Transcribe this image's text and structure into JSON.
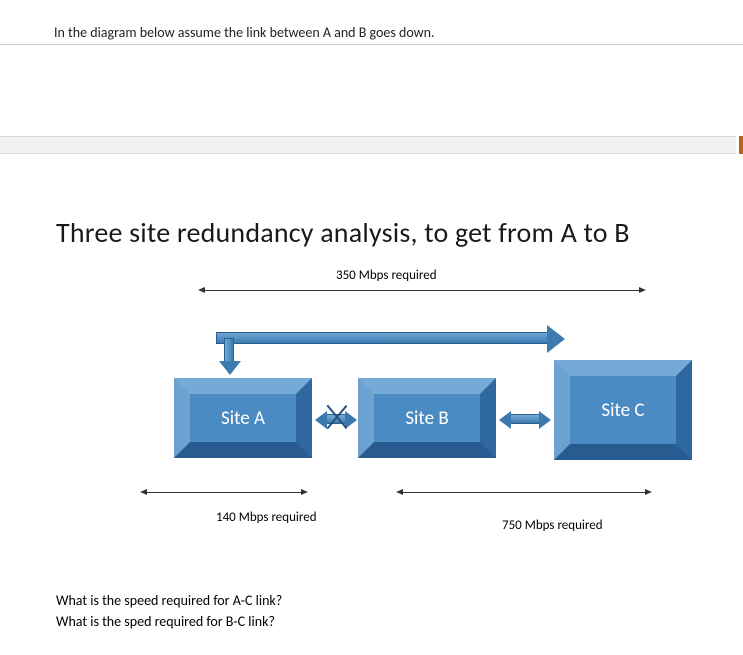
{
  "instruction": "In the diagram below assume the link between A and B goes down.",
  "title": "Three site redundancy analysis, to get from A to B",
  "diagram": {
    "top_req": "350 Mbps required",
    "site_a": "Site A",
    "site_b": "Site B",
    "site_c": "Site C",
    "ab_req": "140  Mbps required",
    "bc_req": "750 Mbps required"
  },
  "questions": {
    "q1": "What is the speed required for A-C link?",
    "q2": "What is the sped required for B-C  link?"
  },
  "chart_data": {
    "type": "diagram",
    "nodes": [
      "Site A",
      "Site B",
      "Site C"
    ],
    "links": [
      {
        "from": "A",
        "to": "B",
        "required_mbps": 140,
        "status": "down"
      },
      {
        "from": "B",
        "to": "C",
        "required_mbps": 750,
        "status": "up"
      },
      {
        "from": "A",
        "to": "C",
        "via_top": true,
        "required_mbps": 350,
        "status": "up"
      }
    ],
    "unknowns": [
      "A-C link speed",
      "B-C link speed"
    ]
  }
}
